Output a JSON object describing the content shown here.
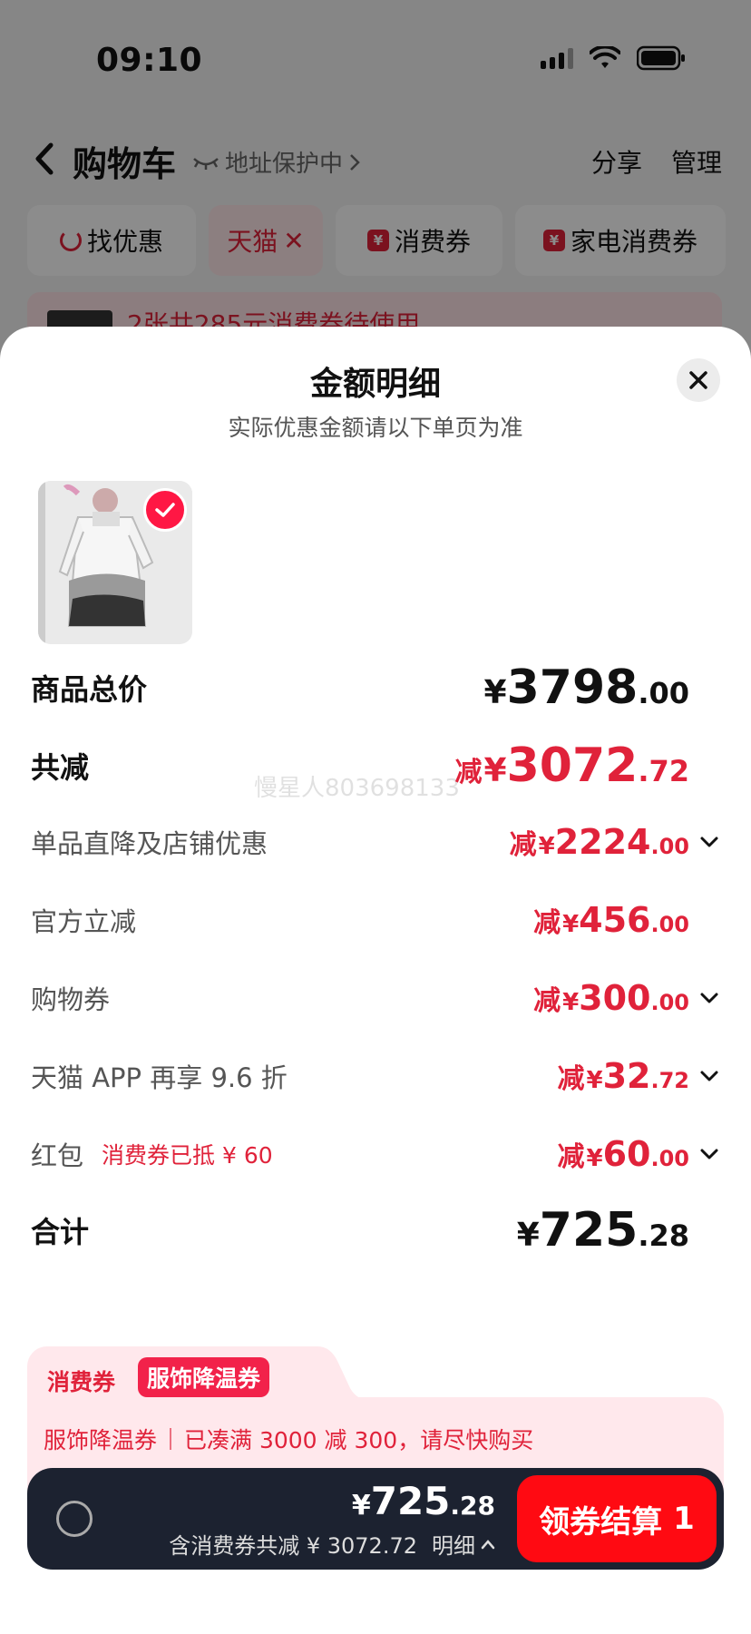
{
  "status": {
    "time": "09:10"
  },
  "cart": {
    "title": "购物车",
    "address_protect": "地址保护中",
    "share": "分享",
    "manage": "管理",
    "filters": [
      {
        "label": "找优惠"
      },
      {
        "label": "天猫"
      },
      {
        "label": "消费券"
      },
      {
        "label": "家电消费券"
      }
    ],
    "coupon_strip": "2张共285元消费券待使用"
  },
  "sheet": {
    "title": "金额明细",
    "subtitle": "实际优惠金额请以下单页为准",
    "watermark": "慢星人803698133",
    "rows": {
      "goods_total": {
        "label": "商品总价",
        "currency": "¥",
        "int": "3798",
        "dec": ".00"
      },
      "total_reduction": {
        "label": "共减",
        "prefix": "减",
        "currency": "¥",
        "int": "3072",
        "dec": ".72"
      },
      "store_discount": {
        "label": "单品直降及店铺优惠",
        "prefix": "减",
        "currency": "¥",
        "int": "2224",
        "dec": ".00"
      },
      "official": {
        "label": "官方立减",
        "prefix": "减",
        "currency": "¥",
        "int": "456",
        "dec": ".00"
      },
      "shopping_voucher": {
        "label": "购物券",
        "prefix": "减",
        "currency": "¥",
        "int": "300",
        "dec": ".00"
      },
      "app_discount": {
        "label": "天猫 APP 再享 9.6 折",
        "prefix": "减",
        "currency": "¥",
        "int": "32",
        "dec": ".72"
      },
      "red_packet": {
        "label": "红包",
        "note": "消费券已抵 ¥ 60",
        "prefix": "减",
        "currency": "¥",
        "int": "60",
        "dec": ".00"
      },
      "sum": {
        "label": "合计",
        "currency": "¥",
        "int": "725",
        "dec": ".28"
      }
    }
  },
  "promo": {
    "tab_label": "消费券",
    "pill": "服饰降温券",
    "line_name": "服饰降温券",
    "line_text": "已凑满 3000 减 300，请尽快购买"
  },
  "checkout": {
    "currency": "¥",
    "int": "725",
    "dec": ".28",
    "savings": "含消费券共减 ¥ 3072.72",
    "detail": "明细",
    "button": "领券结算",
    "count": "1"
  },
  "colors": {
    "accent": "#e0223a",
    "checkout_bg": "#1c2230",
    "button": "#ff0a12"
  }
}
